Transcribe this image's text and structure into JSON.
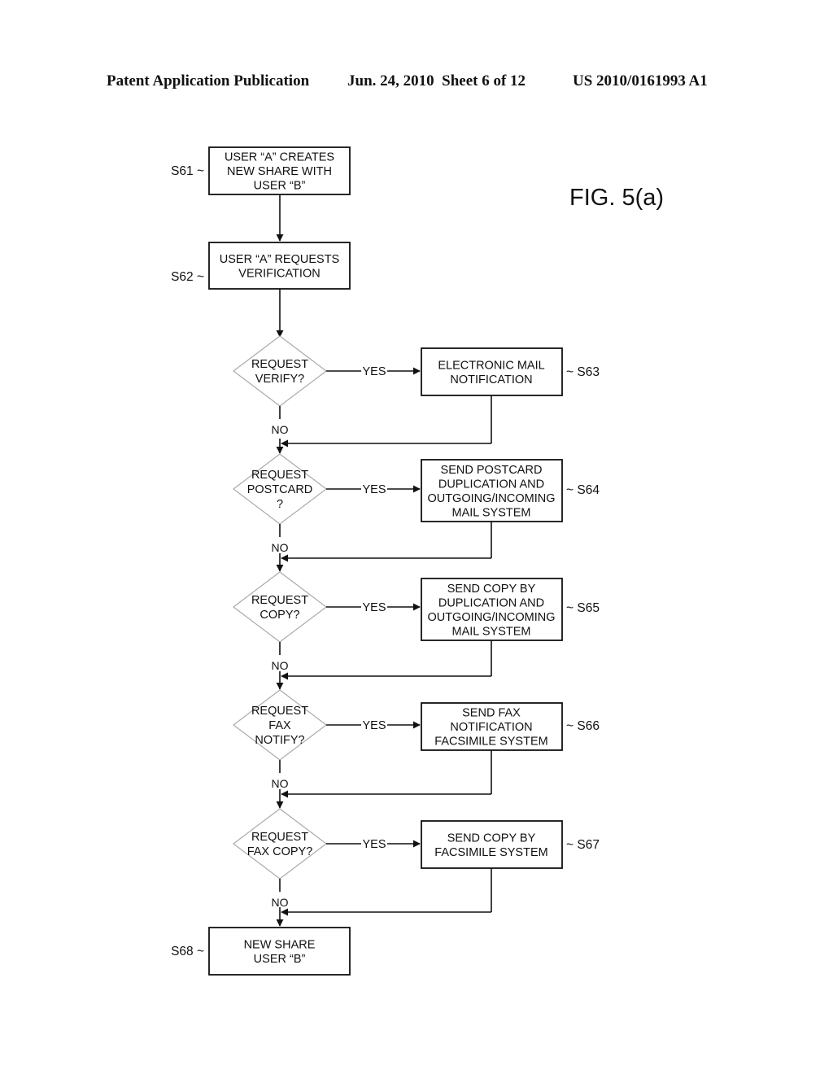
{
  "header": {
    "publication": "Patent Application Publication",
    "date_sheet": "Jun. 24, 2010  Sheet 6 of 12",
    "number": "US 2010/0161993 A1"
  },
  "figure": {
    "title": "FIG. 5(a)",
    "process_boxes": [
      {
        "step": "S61 ~",
        "lines": [
          "USER “A” CREATES",
          "NEW SHARE WITH",
          "USER “B”"
        ]
      },
      {
        "step": "S62 ~",
        "lines": [
          "USER “A” REQUESTS",
          "VERIFICATION"
        ]
      },
      {
        "step": "S68 ~",
        "lines": [
          "NEW SHARE",
          "USER “B”"
        ]
      }
    ],
    "decisions": [
      {
        "lines": [
          "REQUEST",
          "VERIFY?"
        ],
        "yes_label": "YES",
        "no_label": "NO",
        "action": {
          "step": "~ S63",
          "lines": [
            "ELECTRONIC MAIL",
            "NOTIFICATION"
          ]
        }
      },
      {
        "lines": [
          "REQUEST",
          "POSTCARD",
          "?"
        ],
        "yes_label": "YES",
        "no_label": "NO",
        "action": {
          "step": "~ S64",
          "lines": [
            "SEND POSTCARD",
            "DUPLICATION AND",
            "OUTGOING/INCOMING",
            "MAIL SYSTEM"
          ]
        }
      },
      {
        "lines": [
          "REQUEST",
          "COPY?"
        ],
        "yes_label": "YES",
        "no_label": "NO",
        "action": {
          "step": "~ S65",
          "lines": [
            "SEND COPY BY",
            "DUPLICATION AND",
            "OUTGOING/INCOMING",
            "MAIL SYSTEM"
          ]
        }
      },
      {
        "lines": [
          "REQUEST",
          "FAX",
          "NOTIFY?"
        ],
        "yes_label": "YES",
        "no_label": "NO",
        "action": {
          "step": "~ S66",
          "lines": [
            "SEND FAX",
            "NOTIFICATION",
            "FACSIMILE SYSTEM"
          ]
        }
      },
      {
        "lines": [
          "REQUEST",
          "FAX COPY?"
        ],
        "yes_label": "YES",
        "no_label": "NO",
        "action": {
          "step": "~ S67",
          "lines": [
            "SEND COPY BY",
            "FACSIMILE SYSTEM"
          ]
        }
      }
    ]
  }
}
